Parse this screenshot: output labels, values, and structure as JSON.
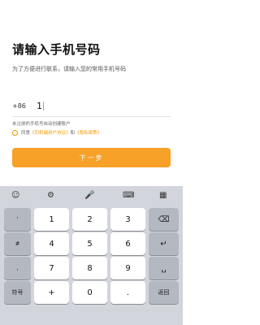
{
  "title": "请输入手机号码",
  "subtitle": "为了方便进行联系，请输入您的常用手机号码",
  "phone": {
    "country_code": "+86",
    "value": "1"
  },
  "note": "未注册的手机号自动创建账户",
  "agreement": {
    "prefix": "同意",
    "link1": "《司机端用户协议》",
    "and": "和",
    "link2": "《隐私政策》"
  },
  "next_button": "下一步",
  "keyboard": {
    "toolbar": [
      "☺",
      "⚙",
      "🎤",
      "⌨",
      "▦"
    ],
    "side_keys": [
      "'",
      "#",
      ",",
      "."
    ],
    "digits": [
      "1",
      "2",
      "3",
      "4",
      "5",
      "6",
      "7",
      "8",
      "9"
    ],
    "symbol_key": "符号",
    "plus_key": "+",
    "zero_key": "0",
    "dot_key": ".",
    "return_key": "返回",
    "backspace_icon": "⌫",
    "enter_icon": "↵",
    "space_icon": "␣"
  },
  "colors": {
    "accent": "#f39800",
    "button": "#f7a128",
    "keyboard_bg": "#d2d5db"
  }
}
